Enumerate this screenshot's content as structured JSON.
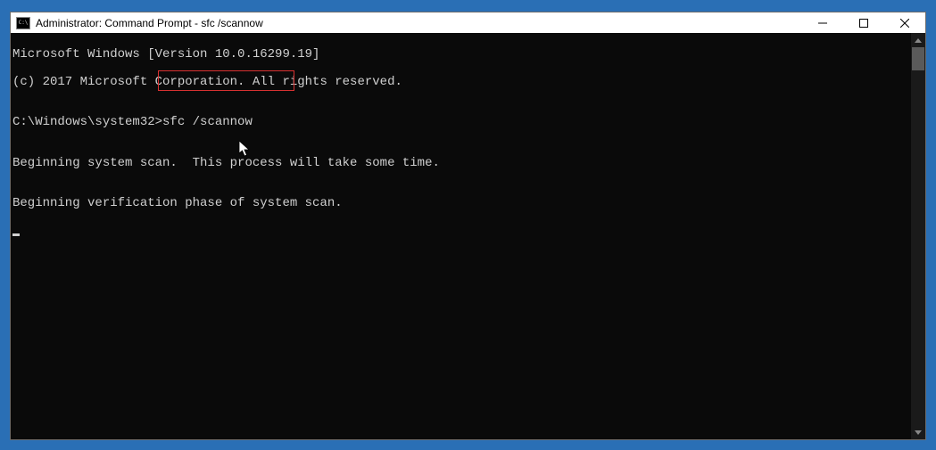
{
  "titlebar": {
    "icon_label": "C:\\",
    "title": "Administrator: Command Prompt - sfc  /scannow"
  },
  "console": {
    "line1": "Microsoft Windows [Version 10.0.16299.19]",
    "line2": "(c) 2017 Microsoft Corporation. All rights reserved.",
    "prompt": "C:\\Windows\\system32>",
    "command": "sfc /scannow",
    "line5": "Beginning system scan.  This process will take some time.",
    "line7": "Beginning verification phase of system scan."
  }
}
